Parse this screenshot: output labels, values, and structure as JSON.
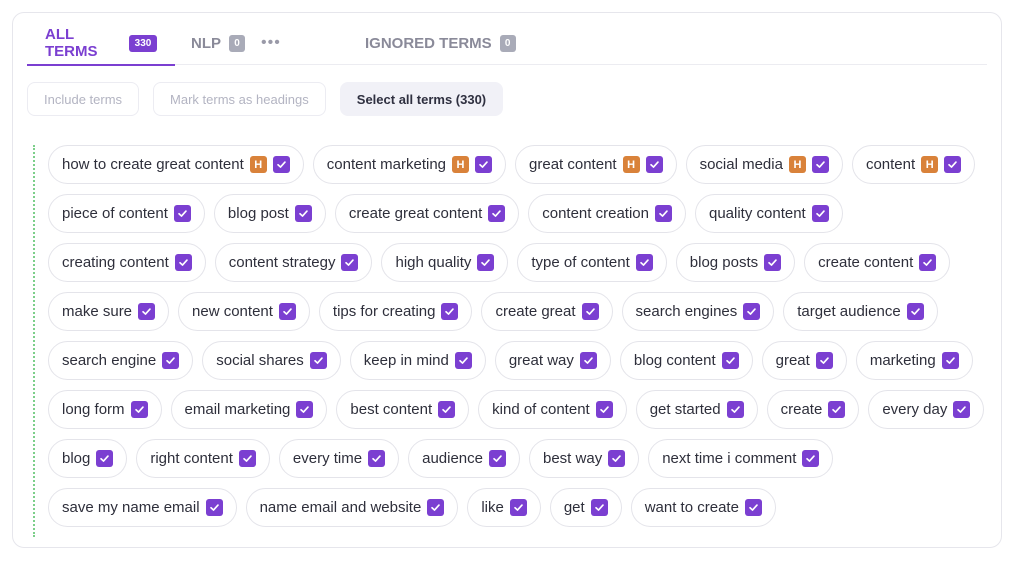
{
  "tabs": [
    {
      "label": "ALL TERMS",
      "count": "330",
      "active": true
    },
    {
      "label": "NLP",
      "count": "0",
      "active": false
    },
    {
      "label": "IGNORED TERMS",
      "count": "0",
      "active": false
    }
  ],
  "more_label": "•••",
  "actions": {
    "include": "Include terms",
    "mark_headings": "Mark terms as headings",
    "select_all": "Select all terms (330)"
  },
  "heading_badge": "H",
  "colors": {
    "accent": "#7b3fd1",
    "heading_badge": "#d9823a",
    "dotted_line": "#7ccf8a"
  },
  "terms": [
    {
      "label": "how to create great content",
      "heading": true
    },
    {
      "label": "content marketing",
      "heading": true
    },
    {
      "label": "great content",
      "heading": true
    },
    {
      "label": "social media",
      "heading": true
    },
    {
      "label": "content",
      "heading": true
    },
    {
      "label": "piece of content",
      "heading": false
    },
    {
      "label": "blog post",
      "heading": false
    },
    {
      "label": "create great content",
      "heading": false
    },
    {
      "label": "content creation",
      "heading": false
    },
    {
      "label": "quality content",
      "heading": false
    },
    {
      "label": "creating content",
      "heading": false
    },
    {
      "label": "content strategy",
      "heading": false
    },
    {
      "label": "high quality",
      "heading": false
    },
    {
      "label": "type of content",
      "heading": false
    },
    {
      "label": "blog posts",
      "heading": false
    },
    {
      "label": "create content",
      "heading": false
    },
    {
      "label": "make sure",
      "heading": false
    },
    {
      "label": "new content",
      "heading": false
    },
    {
      "label": "tips for creating",
      "heading": false
    },
    {
      "label": "create great",
      "heading": false
    },
    {
      "label": "search engines",
      "heading": false
    },
    {
      "label": "target audience",
      "heading": false
    },
    {
      "label": "search engine",
      "heading": false
    },
    {
      "label": "social shares",
      "heading": false
    },
    {
      "label": "keep in mind",
      "heading": false
    },
    {
      "label": "great way",
      "heading": false
    },
    {
      "label": "blog content",
      "heading": false
    },
    {
      "label": "great",
      "heading": false
    },
    {
      "label": "marketing",
      "heading": false
    },
    {
      "label": "long form",
      "heading": false
    },
    {
      "label": "email marketing",
      "heading": false
    },
    {
      "label": "best content",
      "heading": false
    },
    {
      "label": "kind of content",
      "heading": false
    },
    {
      "label": "get started",
      "heading": false
    },
    {
      "label": "create",
      "heading": false
    },
    {
      "label": "every day",
      "heading": false
    },
    {
      "label": "blog",
      "heading": false
    },
    {
      "label": "right content",
      "heading": false
    },
    {
      "label": "every time",
      "heading": false
    },
    {
      "label": "audience",
      "heading": false
    },
    {
      "label": "best way",
      "heading": false
    },
    {
      "label": "next time i comment",
      "heading": false
    },
    {
      "label": "save my name email",
      "heading": false
    },
    {
      "label": "name email and website",
      "heading": false
    },
    {
      "label": "like",
      "heading": false
    },
    {
      "label": "get",
      "heading": false
    },
    {
      "label": "want to create",
      "heading": false
    }
  ]
}
